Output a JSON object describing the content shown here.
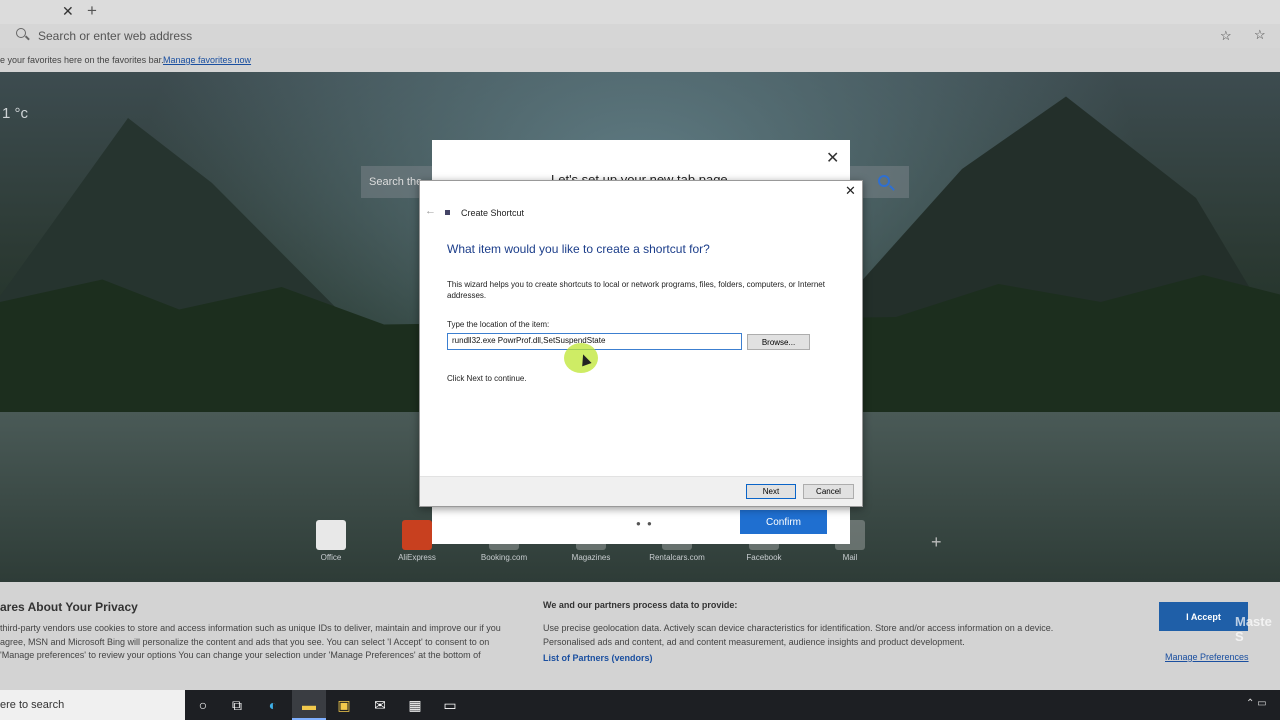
{
  "browser": {
    "address_placeholder": "Search or enter web address",
    "favorites_bar_text": "e your favorites here on the favorites bar.",
    "favorites_manage_link": "Manage favorites now"
  },
  "newtab": {
    "temperature": "1 °c",
    "search_placeholder": "Search the",
    "tiles": [
      "Office",
      "AliExpress",
      "Booking.com",
      "Magazines",
      "Rentalcars.com",
      "Facebook",
      "Mail"
    ]
  },
  "setup_dialog": {
    "title": "Let's set up your new tab page",
    "confirm_label": "Confirm",
    "dots": "● ●"
  },
  "wizard": {
    "app_title": "Create Shortcut",
    "heading": "What item would you like to create a shortcut for?",
    "description": "This wizard helps you to create shortcuts to local or network programs, files, folders, computers, or Internet addresses.",
    "location_label": "Type the location of the item:",
    "location_value": "rundll32.exe PowrProf.dll,SetSuspendState",
    "browse_label": "Browse...",
    "hint": "Click Next to continue.",
    "next_label": "Next",
    "cancel_label": "Cancel"
  },
  "privacy": {
    "title": "ares About Your Privacy",
    "body": "third-party vendors use cookies to store and access information such as unique IDs to deliver, maintain and improve our if you agree, MSN and Microsoft Bing will personalize the content and ads that you see. You can select 'I Accept' to consent to on 'Manage preferences' to review your options You can change your selection under 'Manage Preferences' at the bottom of",
    "right_title": "We and our partners process data to provide:",
    "right_body": "Use precise geolocation data. Actively scan device characteristics for identification. Store and/or access information on a device. Personalised ads and content, ad and content measurement, audience insights and product development.",
    "partners_link": "List of Partners (vendors)",
    "accept_label": "I Accept",
    "manage_link": "Manage Preferences"
  },
  "taskbar": {
    "search_text": "ere to search"
  },
  "watermark": "Maste S"
}
